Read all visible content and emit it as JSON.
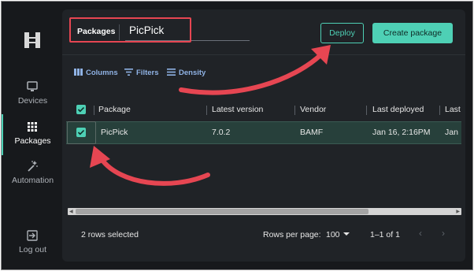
{
  "sidebar": {
    "logo": "hx-logo-icon",
    "items": [
      {
        "label": "Devices",
        "icon": "monitor-icon"
      },
      {
        "label": "Packages",
        "icon": "grid-icon"
      },
      {
        "label": "Automation",
        "icon": "magic-wand-icon"
      }
    ],
    "logout": {
      "label": "Log out",
      "icon": "logout-icon"
    }
  },
  "search": {
    "label": "Packages",
    "value": "PicPick"
  },
  "actions": {
    "deploy": "Deploy",
    "create": "Create package"
  },
  "toolbar": {
    "columns": "Columns",
    "filters": "Filters",
    "density": "Density"
  },
  "table": {
    "headers": [
      "Package",
      "Latest version",
      "Vendor",
      "Last deployed",
      "Last"
    ],
    "rows": [
      {
        "package": "PicPick",
        "version": "7.0.2",
        "vendor": "BAMF",
        "deployed": "Jan 16, 2:16PM",
        "last": "Jan"
      }
    ]
  },
  "footer": {
    "selection": "2 rows selected",
    "rows_per_page_label": "Rows per page:",
    "rows_per_page": "100",
    "range": "1–1 of 1"
  },
  "colors": {
    "accent": "#4ed0b5",
    "annotation": "#e64652"
  }
}
